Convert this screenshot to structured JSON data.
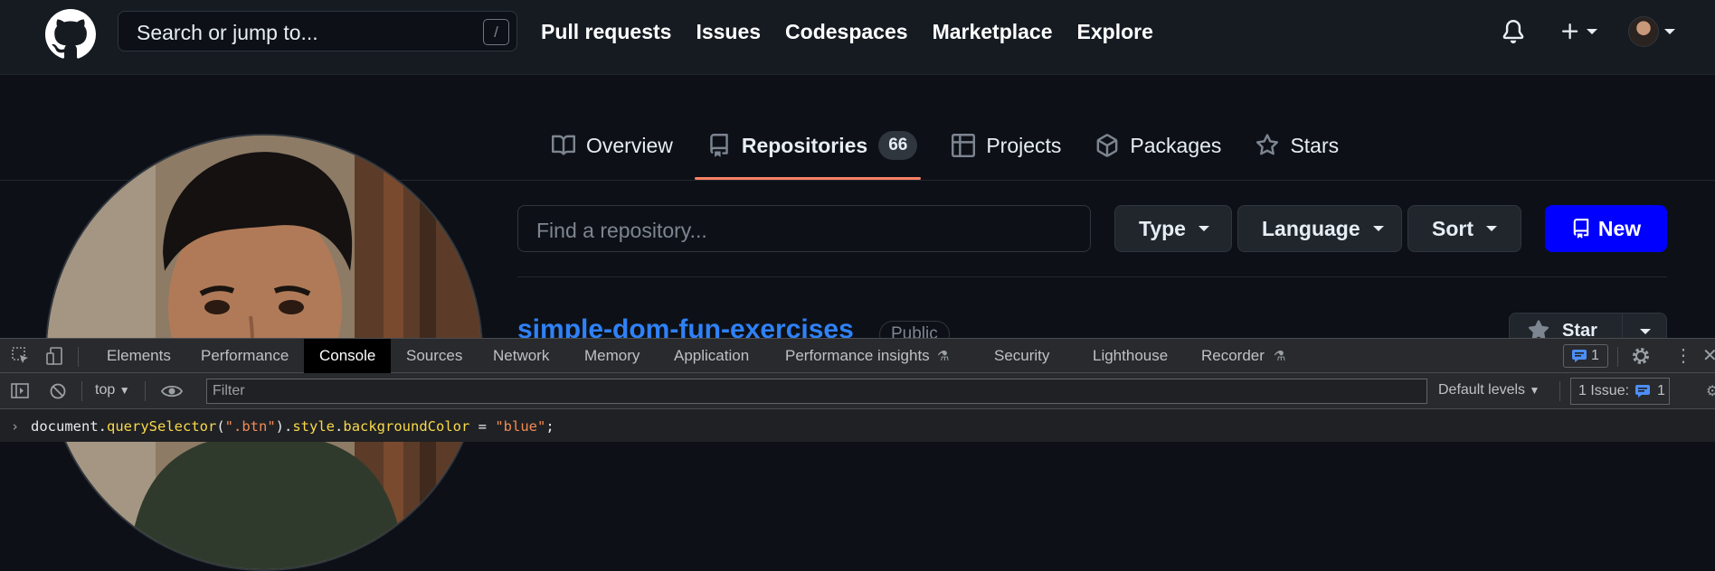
{
  "header": {
    "search_placeholder": "Search or jump to...",
    "search_shortcut": "/",
    "nav": [
      "Pull requests",
      "Issues",
      "Codespaces",
      "Marketplace",
      "Explore"
    ]
  },
  "profile_tabs": {
    "overview": "Overview",
    "repositories": "Repositories",
    "repositories_count": "66",
    "projects": "Projects",
    "packages": "Packages",
    "stars": "Stars"
  },
  "repo_filter": {
    "find_placeholder": "Find a repository...",
    "type": "Type",
    "language": "Language",
    "sort": "Sort",
    "new": "New",
    "new_button_color": "#0000ff"
  },
  "repo": {
    "name": "simple-dom-fun-exercises",
    "visibility": "Public",
    "star_label": "Star"
  },
  "devtools": {
    "tabs": [
      "Elements",
      "Performance",
      "Console",
      "Sources",
      "Network",
      "Memory",
      "Application",
      "Performance insights",
      "Security",
      "Lighthouse",
      "Recorder"
    ],
    "active_tab": "Console",
    "messages_count": "1",
    "context": "top",
    "filter_placeholder": "Filter",
    "levels": "Default levels",
    "issues_label": "1 Issue:",
    "issues_count": "1",
    "console_input": {
      "prefix": "document.",
      "method": "querySelector",
      "open": "(",
      "selector": "\".btn\"",
      "close": ").",
      "style": "style",
      "dot": ".",
      "prop": "backgroundColor",
      "eq": " = ",
      "value": "\"blue\"",
      "end": ";"
    }
  },
  "icons": [
    "github-logo-icon",
    "bell-icon",
    "plus-icon",
    "book-icon",
    "repo-icon",
    "table-icon",
    "package-icon",
    "star-icon",
    "inspect-icon",
    "device-icon",
    "gear-icon",
    "kebab-icon",
    "close-icon",
    "sidebar-icon",
    "clear-icon",
    "eye-icon"
  ]
}
